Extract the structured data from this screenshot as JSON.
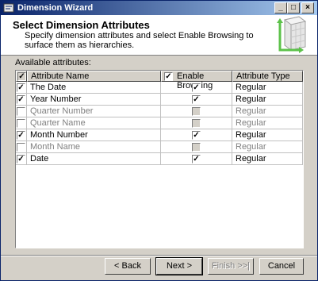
{
  "window": {
    "title": "Dimension Wizard"
  },
  "header": {
    "title": "Select Dimension Attributes",
    "description": "Specify dimension attributes and select Enable Browsing to surface them as hierarchies."
  },
  "attributes": {
    "label": "Available attributes:",
    "columns": {
      "name": "Attribute Name",
      "browsing": "Enable Browsing",
      "type": "Attribute Type"
    },
    "rows": [
      {
        "name": "The Date",
        "type": "Regular",
        "selected": true,
        "browsing": true
      },
      {
        "name": "Year Number",
        "type": "Regular",
        "selected": true,
        "browsing": true
      },
      {
        "name": "Quarter Number",
        "type": "Regular",
        "selected": false,
        "browsing": true
      },
      {
        "name": "Quarter Name",
        "type": "Regular",
        "selected": false,
        "browsing": true
      },
      {
        "name": "Month Number",
        "type": "Regular",
        "selected": true,
        "browsing": true
      },
      {
        "name": "Month Name",
        "type": "Regular",
        "selected": false,
        "browsing": true
      },
      {
        "name": "Date",
        "type": "Regular",
        "selected": true,
        "browsing": true
      }
    ]
  },
  "buttons": {
    "back": "< Back",
    "next": "Next >",
    "finish": "Finish >>|",
    "cancel": "Cancel"
  }
}
